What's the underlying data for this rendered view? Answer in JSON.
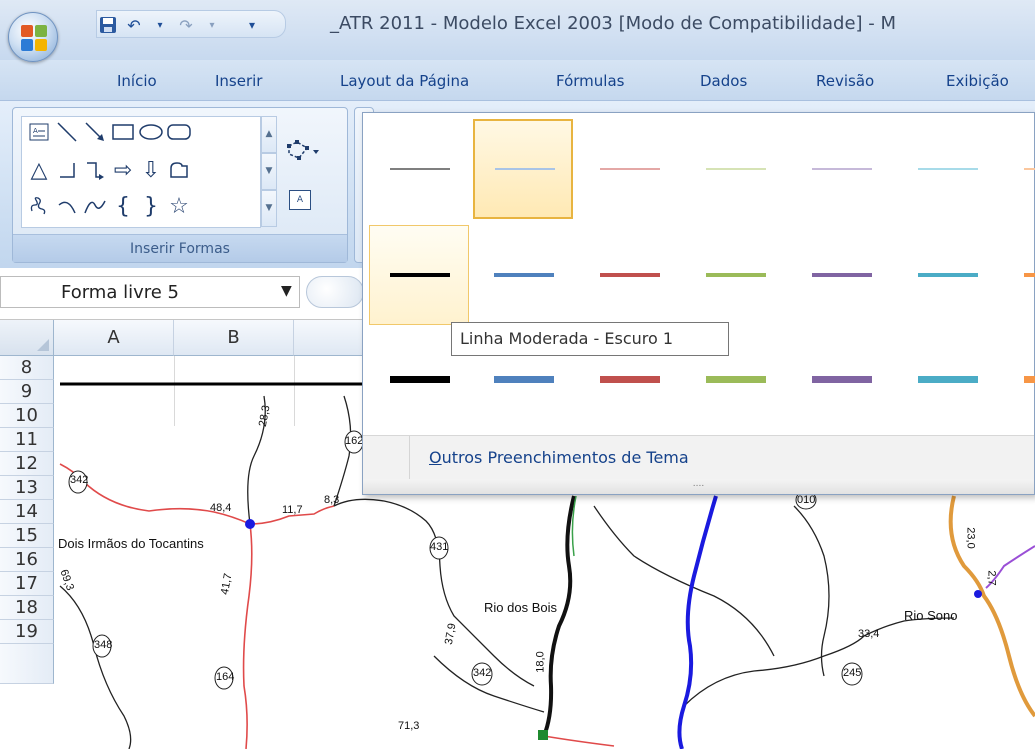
{
  "title_bar": {
    "title": "_ATR 2011 - Modelo Excel 2003  [Modo de Compatibilidade] - M",
    "quick_access": [
      "save-icon",
      "undo-icon",
      "redo-icon",
      "customize-icon"
    ]
  },
  "tabs": [
    "Início",
    "Inserir",
    "Layout da Página",
    "Fórmulas",
    "Dados",
    "Revisão",
    "Exibição"
  ],
  "ribbon": {
    "group_label": "Inserir Formas",
    "textbox_glyph": "A"
  },
  "formula_bar": {
    "name_box": "Forma livre 5",
    "name_box_arrow": "▼"
  },
  "sheet": {
    "columns": [
      "A",
      "B"
    ],
    "rows": [
      "8",
      "9",
      "10",
      "11",
      "12",
      "13",
      "14",
      "15",
      "16",
      "17",
      "18",
      "19"
    ]
  },
  "map": {
    "places": [
      "Dois Irmãos do Tocantins",
      "Rio dos Bois",
      "Rio Sono"
    ],
    "road_numbers": [
      "342",
      "431",
      "348",
      "164",
      "342",
      "245",
      "162",
      "010"
    ],
    "distances": [
      "28,3",
      "48,4",
      "11,7",
      "8,3",
      "69,3",
      "41,7",
      "37,9",
      "18,0",
      "33,4",
      "71,3",
      "23,0",
      "2,7"
    ]
  },
  "dropdown": {
    "tooltip": "Linha Moderada - Escuro 1",
    "more_fill_underline": "O",
    "more_fill_rest": "utros Preenchimentos de Tema",
    "grip": "....",
    "rows": [
      {
        "weight": 2,
        "colors": [
          "#7f7f7f",
          "#a9c4e6",
          "#e4a8a6",
          "#d6e3b5",
          "#c6b9d9",
          "#a7dbe9",
          "#fbc79e"
        ]
      },
      {
        "weight": 4,
        "colors": [
          "#000000",
          "#4f81bd",
          "#c0504d",
          "#9bbb59",
          "#8064a2",
          "#4bacc6",
          "#f79646"
        ]
      },
      {
        "weight": 7,
        "colors": [
          "#000000",
          "#4f81bd",
          "#c0504d",
          "#9bbb59",
          "#8064a2",
          "#4bacc6",
          "#f79646"
        ]
      }
    ],
    "selected_swatch": {
      "row": 0,
      "col": 1
    },
    "hover_swatch": {
      "row": 1,
      "col": 0
    }
  }
}
